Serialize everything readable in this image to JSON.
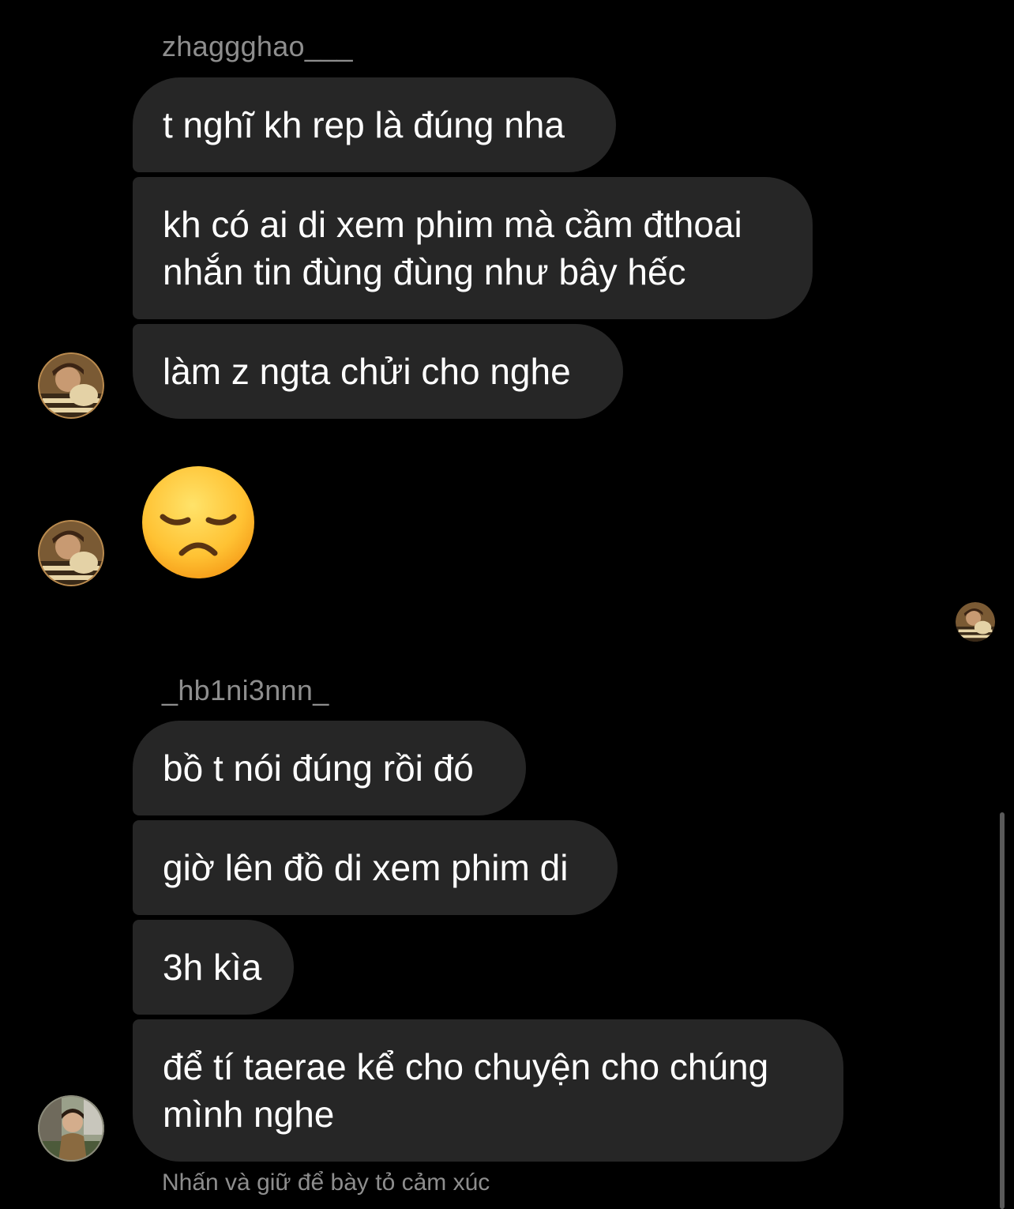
{
  "groups": [
    {
      "sender": "zhaggghao___",
      "messages": [
        "t nghĩ kh rep là đúng nha",
        "kh có ai di xem phim mà cầm đthoai nhắn tin đùng đùng như bây hếc",
        "làm z ngta chửi cho nghe"
      ],
      "emoji_reaction": "disappointed-face-emoji"
    },
    {
      "sender": "_hb1ni3nnn_",
      "messages": [
        "bồ t nói đúng rồi đó",
        "giờ lên đồ di xem phim di",
        "3h kìa",
        "để tí taerae kể cho chuyện cho chúng mình nghe"
      ]
    }
  ],
  "hint": "Nhấn và giữ để bày tỏ cảm xúc",
  "colors": {
    "background": "#000000",
    "bubble": "#262626",
    "muted_text": "#8e8e8e"
  }
}
